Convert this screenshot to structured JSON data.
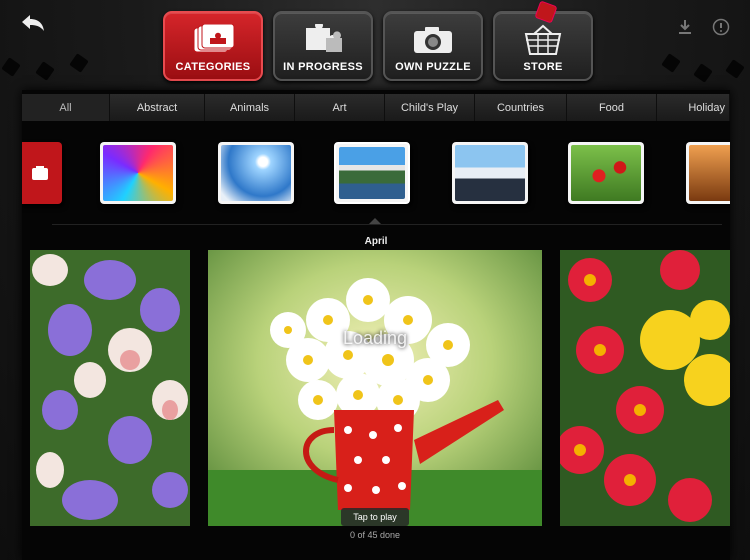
{
  "nav": {
    "buttons": [
      {
        "label": "CATEGORIES",
        "icon": "cards-icon",
        "active": true
      },
      {
        "label": "IN PROGRESS",
        "icon": "puzzle-piece-icon",
        "active": false
      },
      {
        "label": "OWN PUZZLE",
        "icon": "camera-icon",
        "active": false
      },
      {
        "label": "STORE",
        "icon": "basket-icon",
        "active": false
      }
    ]
  },
  "categories": {
    "tabs": [
      "All",
      "Abstract",
      "Animals",
      "Art",
      "Child's Play",
      "Countries",
      "Food",
      "Holiday"
    ]
  },
  "thumbs": [
    "category-own",
    "abstract-swirl",
    "sky-clouds",
    "mountain-lake",
    "penguins",
    "red-apples",
    "camels-sunset"
  ],
  "current_category": "April",
  "puzzle": {
    "loading": "Loading",
    "tap_label": "Tap to play",
    "progress": "0 of 45 done"
  },
  "colors": {
    "active_red": "#c0161b",
    "bar_dark": "#1a1a1a"
  }
}
